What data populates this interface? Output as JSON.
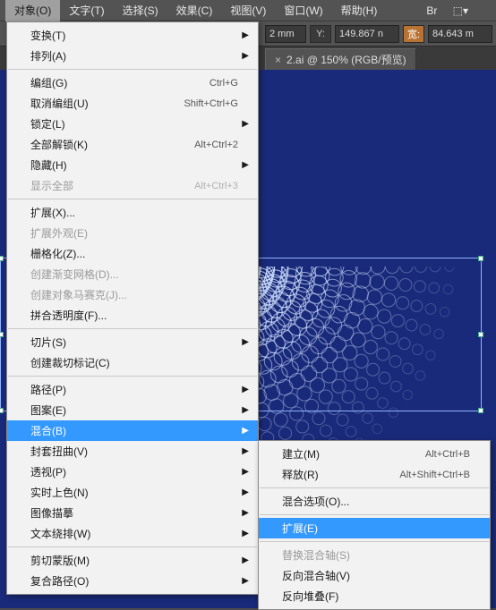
{
  "menubar": {
    "items": [
      "对象(O)",
      "文字(T)",
      "选择(S)",
      "效果(C)",
      "视图(V)",
      "窗口(W)",
      "帮助(H)"
    ],
    "openIndex": 0
  },
  "controls": {
    "x_suffix": "2 mm",
    "y_label": "Y:",
    "y_value": "149.867 n",
    "w_label": "宽:",
    "w_value": "84.643 m"
  },
  "tab": {
    "close": "×",
    "title": "2.ai @ 150% (RGB/预览)"
  },
  "menu": {
    "groups": [
      [
        {
          "label": "变换(T)",
          "sub": true
        },
        {
          "label": "排列(A)",
          "sub": true
        }
      ],
      [
        {
          "label": "编组(G)",
          "shortcut": "Ctrl+G"
        },
        {
          "label": "取消编组(U)",
          "shortcut": "Shift+Ctrl+G"
        },
        {
          "label": "锁定(L)",
          "sub": true
        },
        {
          "label": "全部解锁(K)",
          "shortcut": "Alt+Ctrl+2"
        },
        {
          "label": "隐藏(H)",
          "sub": true
        },
        {
          "label": "显示全部",
          "shortcut": "Alt+Ctrl+3",
          "disabled": true
        }
      ],
      [
        {
          "label": "扩展(X)..."
        },
        {
          "label": "扩展外观(E)",
          "disabled": true
        },
        {
          "label": "栅格化(Z)..."
        },
        {
          "label": "创建渐变网格(D)...",
          "disabled": true
        },
        {
          "label": "创建对象马赛克(J)...",
          "disabled": true
        },
        {
          "label": "拼合透明度(F)..."
        }
      ],
      [
        {
          "label": "切片(S)",
          "sub": true
        },
        {
          "label": "创建裁切标记(C)"
        }
      ],
      [
        {
          "label": "路径(P)",
          "sub": true
        },
        {
          "label": "图案(E)",
          "sub": true
        },
        {
          "label": "混合(B)",
          "sub": true,
          "hl": true
        },
        {
          "label": "封套扭曲(V)",
          "sub": true
        },
        {
          "label": "透视(P)",
          "sub": true
        },
        {
          "label": "实时上色(N)",
          "sub": true
        },
        {
          "label": "图像描摹",
          "sub": true
        },
        {
          "label": "文本绕排(W)",
          "sub": true
        }
      ],
      [
        {
          "label": "剪切蒙版(M)",
          "sub": true
        },
        {
          "label": "复合路径(O)",
          "sub": true
        }
      ]
    ]
  },
  "submenu": {
    "groups": [
      [
        {
          "label": "建立(M)",
          "shortcut": "Alt+Ctrl+B"
        },
        {
          "label": "释放(R)",
          "shortcut": "Alt+Shift+Ctrl+B"
        }
      ],
      [
        {
          "label": "混合选项(O)..."
        }
      ],
      [
        {
          "label": "扩展(E)",
          "hl": true
        }
      ],
      [
        {
          "label": "替换混合轴(S)",
          "disabled": true
        },
        {
          "label": "反向混合轴(V)"
        },
        {
          "label": "反向堆叠(F)"
        }
      ]
    ]
  }
}
